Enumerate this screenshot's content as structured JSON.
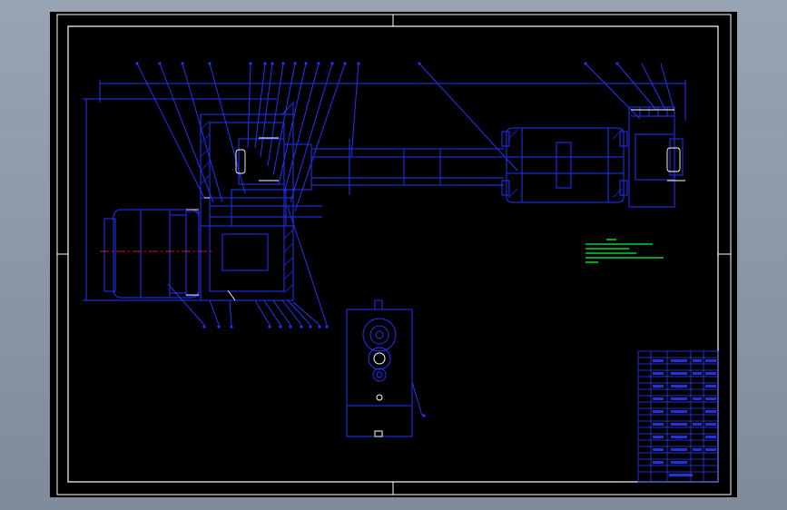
{
  "viewer": {
    "background": "#8a96a6",
    "sheet_background": "#000000"
  },
  "colors": {
    "frame": "#ffffff",
    "geometry": "#2233ff",
    "hatch": "#1a2aee",
    "centerline": "#ff2a2a",
    "notes": "#00ff33",
    "title_block": "#2a3cff"
  },
  "drawing": {
    "tech_notes": {
      "visible": true
    },
    "title_block": {
      "rows": 18
    },
    "part_balloon_count_top": 17,
    "part_balloon_count_bottom": 11
  }
}
